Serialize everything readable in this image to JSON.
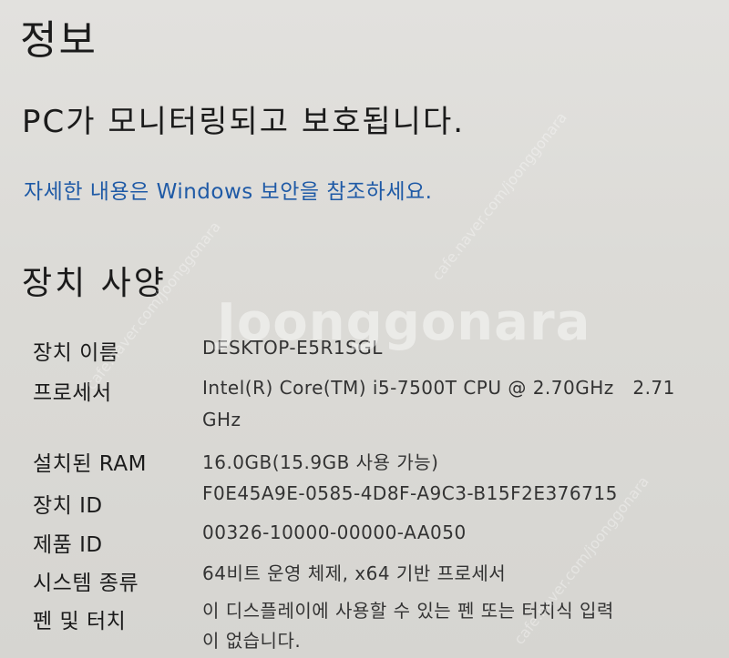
{
  "page": {
    "title": "정보",
    "status": "PC가 모니터링되고 보호됩니다.",
    "security_link": "자세한 내용은 Windows 보안을 참조하세요."
  },
  "device_specs": {
    "title": "장치 사양",
    "rows": [
      {
        "label": "장치 이름",
        "value": "DESKTOP-E5R1SGL"
      },
      {
        "label": "프로세서",
        "value": "Intel(R) Core(TM) i5-7500T CPU @ 2.70GHz   2.71",
        "value2": "GHz"
      },
      {
        "label": "설치된 RAM",
        "value": "16.0GB(15.9GB 사용 가능)"
      },
      {
        "label": "장치 ID",
        "value": "F0E45A9E-0585-4D8F-A9C3-B15F2E376715"
      },
      {
        "label": "제품 ID",
        "value": "00326-10000-00000-AA050"
      },
      {
        "label": "시스템 종류",
        "value": "64비트 운영 체제, x64 기반 프로세서"
      },
      {
        "label": "펜 및 터치",
        "value": "이 디스플레이에 사용할 수 있는 펜 또는 터치식 입력",
        "value2": "이 없습니다."
      }
    ]
  },
  "watermark": {
    "text": "Joonggonara",
    "diagonal": "cafe.naver.com/joonggonara"
  }
}
